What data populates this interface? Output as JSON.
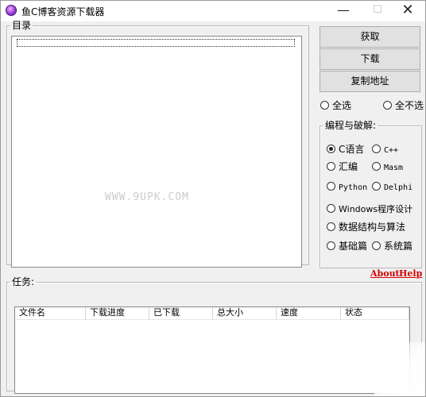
{
  "window": {
    "title": "鱼C博客资源下载器"
  },
  "titlebar": {
    "minimize": "—",
    "maximize": "☐",
    "close": "✕"
  },
  "catalog": {
    "legend": "目录"
  },
  "buttons": {
    "fetch": "获取",
    "download": "下载",
    "copy_address": "复制地址"
  },
  "selection": {
    "select_all": "全选",
    "select_none": "全不选"
  },
  "programming": {
    "legend": "编程与破解:",
    "options": [
      "C语言",
      "C++",
      "汇编",
      "Masm",
      "Python",
      "Delphi",
      "Windows程序设计",
      "数据结构与算法",
      "基础篇",
      "系统篇"
    ],
    "selected": "C语言"
  },
  "links": {
    "about": "About",
    "help": "Help"
  },
  "tasks": {
    "legend": "任务:",
    "columns": [
      "文件名",
      "下载进度",
      "已下载",
      "总大小",
      "速度",
      "状态"
    ]
  },
  "watermark": "WWW.9UPK.COM"
}
